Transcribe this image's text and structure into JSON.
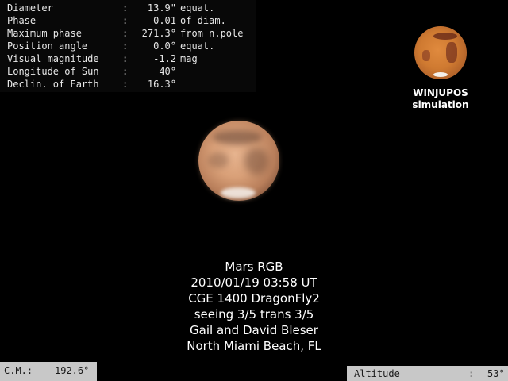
{
  "ephemeris": [
    {
      "label": "Diameter",
      "value": "13.9\"",
      "unit": "equat."
    },
    {
      "label": "Phase",
      "value": "0.01",
      "unit": "of diam."
    },
    {
      "label": "Maximum phase",
      "value": "271.3°",
      "unit": "from n.pole"
    },
    {
      "label": "Position angle",
      "value": "0.0°",
      "unit": "equat."
    },
    {
      "label": "Visual magnitude",
      "value": "-1.2",
      "unit": "mag"
    },
    {
      "label": "Longitude of Sun",
      "value": "40°",
      "unit": ""
    },
    {
      "label": "Declin. of Earth",
      "value": "16.3°",
      "unit": ""
    }
  ],
  "colon": ":",
  "simulation": {
    "line1": "WINJUPOS",
    "line2": "simulation"
  },
  "caption": [
    "Mars  RGB",
    "2010/01/19  03:58 UT",
    "CGE 1400  DragonFly2",
    "seeing 3/5 trans 3/5",
    "Gail and David Bleser",
    "North Miami Beach, FL"
  ],
  "cm": {
    "label": "C.M.:",
    "value": "192.6°"
  },
  "altitude": {
    "label": "Altitude",
    "colon": ":",
    "value": "53°"
  }
}
